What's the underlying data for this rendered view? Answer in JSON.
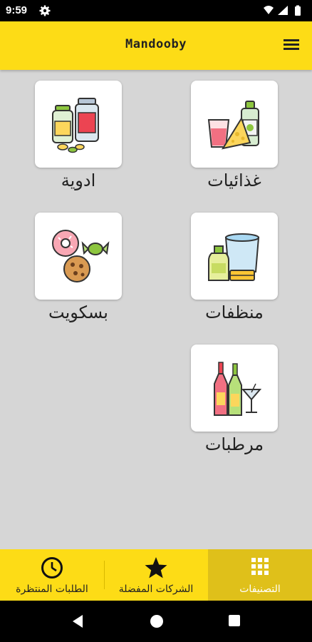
{
  "status": {
    "time": "9:59"
  },
  "app": {
    "title": "Mandooby"
  },
  "categories": [
    {
      "label": "غذائيات",
      "icon": "food-icon"
    },
    {
      "label": "ادوية",
      "icon": "medicine-icon"
    },
    {
      "label": "منظفات",
      "icon": "cleaners-icon"
    },
    {
      "label": "بسكويت",
      "icon": "biscuits-icon"
    },
    {
      "label": "مرطبات",
      "icon": "drinks-icon"
    }
  ],
  "bottom_nav": [
    {
      "label": "التصنيفات",
      "icon": "grid-icon",
      "active": true
    },
    {
      "label": "الشركات المفضلة",
      "icon": "star-icon",
      "active": false
    },
    {
      "label": "الطلبات المنتظرة",
      "icon": "clock-icon",
      "active": false
    }
  ],
  "colors": {
    "accent": "#fddc16",
    "active_tab": "#dfc01a",
    "background": "#d6d6d6"
  }
}
